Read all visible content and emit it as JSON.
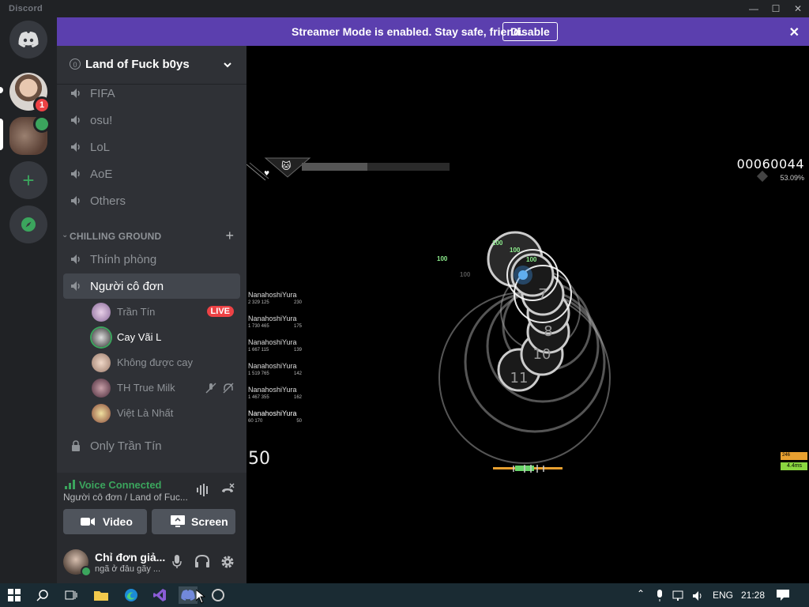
{
  "window": {
    "app_name": "Discord"
  },
  "banner": {
    "message": "Streamer Mode is enabled. Stay safe, friend.",
    "disable_label": "Disable"
  },
  "guilds": {
    "mention_count": "1"
  },
  "server": {
    "name": "Land of Fuck b0ys",
    "channels_top": [
      "FIFA",
      "osu!",
      "LoL",
      "AoE",
      "Others"
    ],
    "category": "CHILLING GROUND",
    "channels_cat": [
      "Thính phòng",
      "Người cô đơn"
    ],
    "voice_users": [
      {
        "name": "Trần Tín",
        "live": "LIVE"
      },
      {
        "name": "Cay Vãi L"
      },
      {
        "name": "Không được cay"
      },
      {
        "name": "TH True Milk"
      },
      {
        "name": "Việt Là Nhất"
      }
    ],
    "locked_channel": "Only Trần Tín"
  },
  "voice": {
    "status": "Voice Connected",
    "location": "Người cô đơn / Land of Fuc...",
    "video_label": "Video",
    "screen_label": "Screen"
  },
  "user": {
    "name": "Chỉ đơn giả...",
    "status_text": "ngã ở đâu gãy ..."
  },
  "game": {
    "score": "00060044",
    "accuracy": "53.09%",
    "combo": "50",
    "leaderboard": [
      {
        "name": "NanahoshiYura",
        "score": "2 329 125",
        "combo": "230"
      },
      {
        "name": "NanahoshiYura",
        "score": "1 730 465",
        "combo": "175"
      },
      {
        "name": "NanahoshiYura",
        "score": "1 667 115",
        "combo": "139"
      },
      {
        "name": "NanahoshiYura",
        "score": "1 519 765",
        "combo": "142"
      },
      {
        "name": "NanahoshiYura",
        "score": "1 467 355",
        "combo": "162"
      },
      {
        "name": "NanahoshiYura",
        "score": "60 170",
        "combo": "50"
      }
    ],
    "hit_labels": [
      "100",
      "100",
      "100",
      "100",
      "100"
    ],
    "fps": "246",
    "latency": "4.4ms"
  },
  "taskbar": {
    "lang": "ENG",
    "time": "21:28"
  },
  "colors": {
    "accent": "#5b3fae",
    "green": "#3ba55d",
    "red": "#ed4245",
    "sidebar": "#2f3136"
  }
}
